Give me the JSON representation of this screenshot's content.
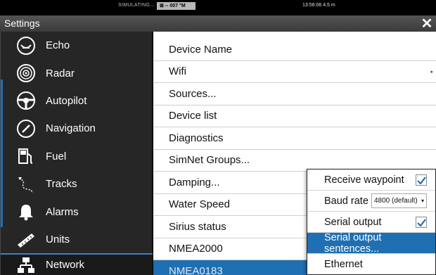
{
  "status_bar": {
    "simulating": "SIMULATING...",
    "gps": "⊠ -- 007 °M",
    "clock": "13:56:06  4.5 m"
  },
  "window": {
    "title": "Settings",
    "close_icon": "✕"
  },
  "sidebar": {
    "items": [
      {
        "label": "Echo",
        "icon": "echo-icon"
      },
      {
        "label": "Radar",
        "icon": "radar-icon"
      },
      {
        "label": "Autopilot",
        "icon": "autopilot-icon"
      },
      {
        "label": "Navigation",
        "icon": "navigation-icon"
      },
      {
        "label": "Fuel",
        "icon": "fuel-icon"
      },
      {
        "label": "Tracks",
        "icon": "tracks-icon"
      },
      {
        "label": "Alarms",
        "icon": "alarms-icon"
      },
      {
        "label": "Units",
        "icon": "units-icon"
      },
      {
        "label": "Network",
        "icon": "network-icon"
      }
    ]
  },
  "network_list": {
    "items": [
      {
        "label": "Device Name"
      },
      {
        "label": "Wifi",
        "arrow": "▸"
      },
      {
        "label": "Sources..."
      },
      {
        "label": "Device list"
      },
      {
        "label": "Diagnostics"
      },
      {
        "label": "SimNet Groups..."
      },
      {
        "label": "Damping..."
      },
      {
        "label": "Water Speed"
      },
      {
        "label": "Sirius status"
      },
      {
        "label": "NMEA2000"
      },
      {
        "label": "NMEA0183"
      }
    ]
  },
  "nmea0183_popup": {
    "receive_waypoint": {
      "label": "Receive waypoint",
      "checked": true
    },
    "baud_rate": {
      "label": "Baud rate",
      "value": "4800 (default)",
      "dropdown": "▾"
    },
    "serial_output": {
      "label": "Serial output",
      "checked": true
    },
    "serial_output_sentences": {
      "label": "Serial output sentences..."
    },
    "ethernet": {
      "label": "Ethernet"
    }
  },
  "colors": {
    "accent": "#1f6fb3",
    "sidebar_bg": "#262626",
    "title_bar": "#4a4a4a"
  }
}
